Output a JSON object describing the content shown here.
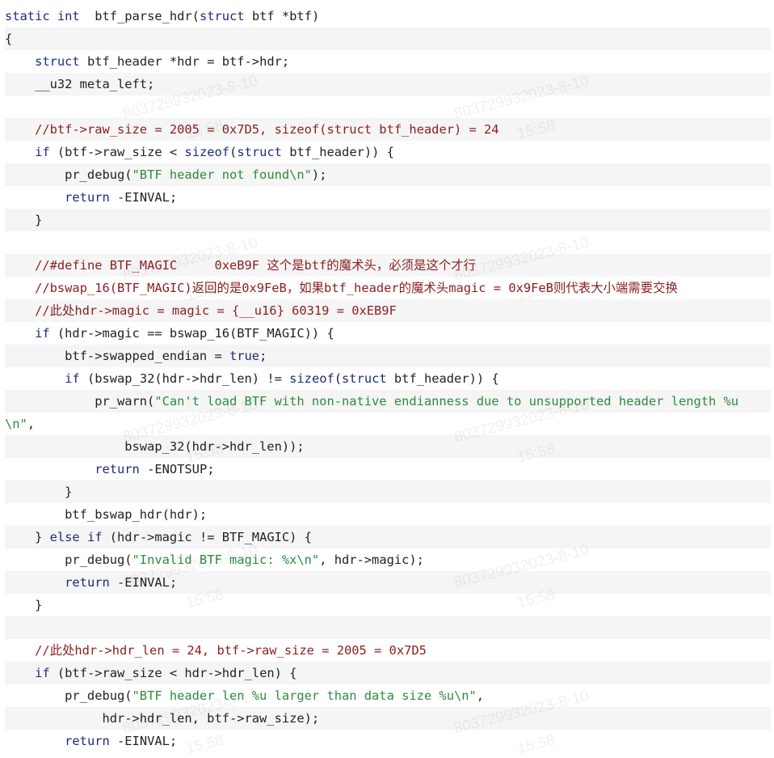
{
  "code": {
    "lines": [
      {
        "alt": false,
        "parts": [
          [
            "kw",
            "static int"
          ],
          [
            "",
            "  btf_parse_hdr("
          ],
          [
            "kw",
            "struct"
          ],
          [
            "",
            " btf *btf)"
          ]
        ]
      },
      {
        "alt": true,
        "parts": [
          [
            "",
            "{"
          ]
        ]
      },
      {
        "alt": false,
        "parts": [
          [
            "",
            "    "
          ],
          [
            "kw",
            "struct"
          ],
          [
            "",
            " btf_header *hdr = btf->hdr;"
          ]
        ]
      },
      {
        "alt": true,
        "parts": [
          [
            "",
            "    __u32 meta_left;"
          ]
        ]
      },
      {
        "alt": false,
        "parts": [
          [
            "",
            ""
          ]
        ]
      },
      {
        "alt": true,
        "parts": [
          [
            "",
            "    "
          ],
          [
            "cm",
            "//btf->raw_size = 2005 = 0x7D5, sizeof(struct btf_header) = 24"
          ]
        ]
      },
      {
        "alt": false,
        "parts": [
          [
            "",
            "    "
          ],
          [
            "kw",
            "if"
          ],
          [
            "",
            " (btf->raw_size < "
          ],
          [
            "kw",
            "sizeof"
          ],
          [
            "",
            "("
          ],
          [
            "kw",
            "struct"
          ],
          [
            "",
            " btf_header)) {"
          ]
        ]
      },
      {
        "alt": true,
        "parts": [
          [
            "",
            "        pr_debug("
          ],
          [
            "st",
            "\"BTF header not found\\n\""
          ],
          [
            "",
            ");"
          ]
        ]
      },
      {
        "alt": false,
        "parts": [
          [
            "",
            "        "
          ],
          [
            "kw",
            "return"
          ],
          [
            "",
            " -EINVAL;"
          ]
        ]
      },
      {
        "alt": true,
        "parts": [
          [
            "",
            "    }"
          ]
        ]
      },
      {
        "alt": false,
        "parts": [
          [
            "",
            ""
          ]
        ]
      },
      {
        "alt": true,
        "parts": [
          [
            "",
            "    "
          ],
          [
            "cm",
            "//#define BTF_MAGIC     0xeB9F 这个是btf的魔术头，必须是这个才行"
          ]
        ]
      },
      {
        "alt": false,
        "parts": [
          [
            "",
            "    "
          ],
          [
            "cm",
            "//bswap_16(BTF_MAGIC)返回的是0x9FeB，如果btf_header的魔术头magic = 0x9FeB则代表大小端需要交换"
          ]
        ]
      },
      {
        "alt": true,
        "parts": [
          [
            "",
            "    "
          ],
          [
            "cm",
            "//此处hdr->magic = magic = {__u16} 60319 = 0xEB9F"
          ]
        ]
      },
      {
        "alt": false,
        "parts": [
          [
            "",
            "    "
          ],
          [
            "kw",
            "if"
          ],
          [
            "",
            " (hdr->magic == bswap_16(BTF_MAGIC)) {"
          ]
        ]
      },
      {
        "alt": true,
        "parts": [
          [
            "",
            "        btf->swapped_endian = "
          ],
          [
            "kw",
            "true"
          ],
          [
            "",
            ";"
          ]
        ]
      },
      {
        "alt": false,
        "parts": [
          [
            "",
            "        "
          ],
          [
            "kw",
            "if"
          ],
          [
            "",
            " (bswap_32(hdr->hdr_len) != "
          ],
          [
            "kw",
            "sizeof"
          ],
          [
            "",
            "("
          ],
          [
            "kw",
            "struct"
          ],
          [
            "",
            " btf_header)) {"
          ]
        ]
      },
      {
        "alt": true,
        "parts": [
          [
            "",
            "            pr_warn("
          ],
          [
            "st",
            "\"Can't load BTF with non-native endianness due to unsupported header length %u"
          ]
        ]
      },
      {
        "alt": false,
        "parts": [
          [
            "st",
            "\\n\""
          ],
          [
            "",
            ","
          ]
        ]
      },
      {
        "alt": true,
        "parts": [
          [
            "",
            "                bswap_32(hdr->hdr_len));"
          ]
        ]
      },
      {
        "alt": false,
        "parts": [
          [
            "",
            "            "
          ],
          [
            "kw",
            "return"
          ],
          [
            "",
            " -ENOTSUP;"
          ]
        ]
      },
      {
        "alt": true,
        "parts": [
          [
            "",
            "        }"
          ]
        ]
      },
      {
        "alt": false,
        "parts": [
          [
            "",
            "        btf_bswap_hdr(hdr);"
          ]
        ]
      },
      {
        "alt": true,
        "parts": [
          [
            "",
            "    } "
          ],
          [
            "kw",
            "else if"
          ],
          [
            "",
            " (hdr->magic != BTF_MAGIC) {"
          ]
        ]
      },
      {
        "alt": false,
        "parts": [
          [
            "",
            "        pr_debug("
          ],
          [
            "st",
            "\"Invalid BTF magic: %x\\n\""
          ],
          [
            "",
            ", hdr->magic);"
          ]
        ]
      },
      {
        "alt": true,
        "parts": [
          [
            "",
            "        "
          ],
          [
            "kw",
            "return"
          ],
          [
            "",
            " -EINVAL;"
          ]
        ]
      },
      {
        "alt": false,
        "parts": [
          [
            "",
            "    }"
          ]
        ]
      },
      {
        "alt": true,
        "parts": [
          [
            "",
            ""
          ]
        ]
      },
      {
        "alt": false,
        "parts": [
          [
            "",
            "    "
          ],
          [
            "cm",
            "//此处hdr->hdr_len = 24, btf->raw_size = 2005 = 0x7D5"
          ]
        ]
      },
      {
        "alt": true,
        "parts": [
          [
            "",
            "    "
          ],
          [
            "kw",
            "if"
          ],
          [
            "",
            " (btf->raw_size < hdr->hdr_len) {"
          ]
        ]
      },
      {
        "alt": false,
        "parts": [
          [
            "",
            "        pr_debug("
          ],
          [
            "st",
            "\"BTF header len %u larger than data size %u\\n\""
          ],
          [
            "",
            ","
          ]
        ]
      },
      {
        "alt": true,
        "parts": [
          [
            "",
            "             hdr->hdr_len, btf->raw_size);"
          ]
        ]
      },
      {
        "alt": false,
        "parts": [
          [
            "",
            "        "
          ],
          [
            "kw",
            "return"
          ],
          [
            "",
            " -EINVAL;"
          ]
        ]
      }
    ]
  },
  "watermarks": [
    "803729932023-8-10",
    "15:58"
  ]
}
